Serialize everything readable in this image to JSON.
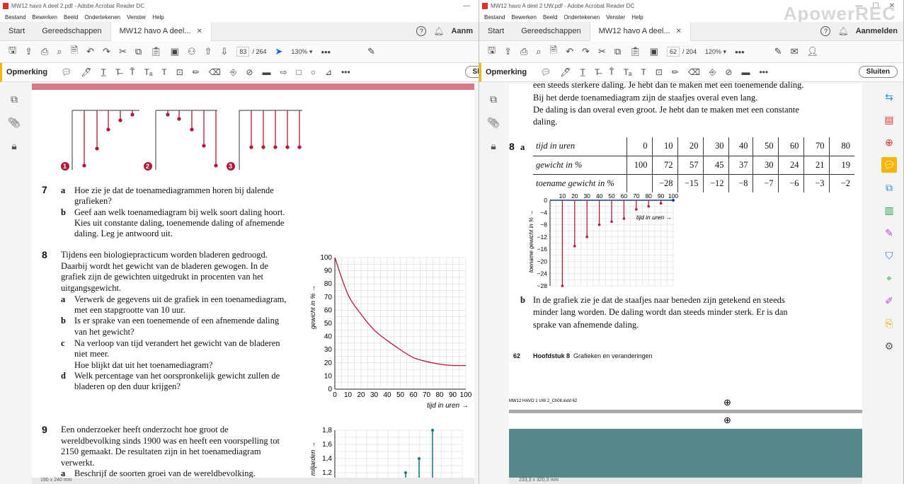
{
  "left": {
    "title": "MW12 havo A deel 2.pdf - Adobe Acrobat Reader DC",
    "menu": [
      "Bestand",
      "Bewerken",
      "Beeld",
      "Ondertekenen",
      "Venster",
      "Help"
    ],
    "tabs": {
      "start": "Start",
      "tools": "Gereedschappen",
      "doc": "MW12 havo A deel..."
    },
    "signin": "Aanm",
    "page_num": "83",
    "page_total": "/ 264",
    "zoom": "130%",
    "anno_label": "Opmerking",
    "close_label": "Sl",
    "status": "190 x 240 mm",
    "diagram_markers": [
      "1",
      "2",
      "3"
    ],
    "q7": {
      "num": "7",
      "a_letter": "a",
      "a1": "Hoe zie je dat de toenamediagrammen horen bij dalende",
      "a2": "grafieken?",
      "b_letter": "b",
      "b1": "Geef aan welk toenamediagram bij welk soort daling hoort.",
      "b2": "Kies uit constante daling, toenemende daling of afnemende",
      "b3": "daling. Leg je antwoord uit."
    },
    "q8": {
      "num": "8",
      "intro1": "Tijdens een biologiepracticum worden bladeren gedroogd.",
      "intro2": "Daarbij wordt het gewicht van de bladeren gewogen. In de",
      "intro3": "grafiek zijn de gewichten uitgedrukt in procenten van het",
      "intro4": "uitgangsgewicht.",
      "a_letter": "a",
      "a1": "Verwerk de gegevens uit de grafiek in een toenamediagram,",
      "a2": "met een stapgrootte van 10 uur.",
      "b_letter": "b",
      "b1": "Is er sprake van een toenemende of een afnemende daling",
      "b2": "van het gewicht?",
      "c_letter": "c",
      "c1": "Na verloop van tijd verandert het gewicht van de bladeren",
      "c2": "niet meer.",
      "c3": "Hoe blijkt dat uit het toenamediagram?",
      "d_letter": "d",
      "d1": "Welk percentage van het oorspronkelijk gewicht zullen de",
      "d2": "bladeren op den duur krijgen?"
    },
    "q9": {
      "num": "9",
      "l1": "Een onderzoeker heeft onderzocht hoe groot de",
      "l2": "wereldbevolking sinds 1900 was en heeft een voorspelling tot",
      "l3": "2150 gemaakt. De resultaten zijn in het toenamediagram",
      "l4": "verwerkt.",
      "a_letter": "a",
      "a1": "Beschrijf de soorten groei van de wereldbevolking."
    }
  },
  "right": {
    "title": "MW12 havo A deel 2 UW.pdf - Adobe Acrobat Reader DC",
    "menu": [
      "Bestand",
      "Bewerken",
      "Beeld",
      "Ondertekenen",
      "Venster",
      "Help"
    ],
    "tabs": {
      "start": "Start",
      "tools": "Gereedschappen",
      "doc": "MW12 havo A deel..."
    },
    "signin": "Aanmelden",
    "page_num": "62",
    "page_total": "/ 204",
    "zoom": "120%",
    "anno_label": "Opmerking",
    "close_label": "Sluiten",
    "status": "233,3 x 320,3 mm",
    "watermark": "ApowerREC",
    "top1": "een steeds sterkere daling. Je hebt dan te maken met een toenemende daling.",
    "top2": "Bij het derde toenamediagram zijn de staafjes overal even lang.",
    "top3": "De daling is dan overal even groot. Je hebt dan te maken met een constante",
    "top4": "daling.",
    "q8_num": "8",
    "q8_letter": "a",
    "table": {
      "rows": [
        [
          "tijd in uren",
          "0",
          "10",
          "20",
          "30",
          "40",
          "50",
          "60",
          "70",
          "80"
        ],
        [
          "gewicht in %",
          "100",
          "72",
          "57",
          "45",
          "37",
          "30",
          "24",
          "21",
          "19"
        ],
        [
          "toename gewicht in %",
          "",
          "−28",
          "−15",
          "−12",
          "−8",
          "−7",
          "−6",
          "−3",
          "−2"
        ]
      ]
    },
    "b_letter": "b",
    "b1": "In de grafiek zie je dat de staafjes naar beneden zijn getekend en steeds",
    "b2": "minder lang worden. De daling wordt dan steeds minder sterk. Er is dan",
    "b3": "sprake van afnemende daling.",
    "footer_num": "62",
    "footer_chap": "Hoofdstuk 8",
    "footer_title": "Grafieken en veranderingen",
    "indd": "MW12 HAVO 1 UW 2_Ch08.indd   62"
  },
  "chart_data": [
    {
      "type": "line",
      "xlabel": "tijd in uren",
      "ylabel": "gewicht in %",
      "x": [
        0,
        10,
        20,
        30,
        40,
        50,
        60,
        70,
        80,
        90,
        100
      ],
      "values": [
        100,
        72,
        57,
        45,
        37,
        30,
        24,
        21,
        19,
        18,
        18
      ],
      "xlim": [
        0,
        100
      ],
      "ylim": [
        0,
        100
      ],
      "xticks": [
        "0",
        "10",
        "20",
        "30",
        "40",
        "50",
        "60",
        "70",
        "80",
        "90",
        "100"
      ],
      "yticks": [
        "0",
        "10",
        "20",
        "30",
        "40",
        "50",
        "60",
        "70",
        "80",
        "90",
        "100"
      ],
      "grid": true
    },
    {
      "type": "bar",
      "xlabel": "tijd in uren",
      "ylabel": "toename gewicht in %",
      "x": [
        10,
        20,
        30,
        40,
        50,
        60,
        70,
        80,
        90
      ],
      "values": [
        -28,
        -15,
        -12,
        -8,
        -7,
        -6,
        -3,
        -2,
        -1
      ],
      "xticks": [
        "10",
        "20",
        "30",
        "40",
        "50",
        "60",
        "70",
        "80",
        "90",
        "100"
      ],
      "yticks": [
        "0",
        "−4",
        "−8",
        "−12",
        "−16",
        "−20",
        "−24",
        "−28"
      ],
      "ylim": [
        -28,
        0
      ],
      "grid": true
    },
    {
      "type": "bar",
      "ylabel": "in miljarden",
      "yticks": [
        "1,2",
        "1,4",
        "1,6",
        "1,8"
      ],
      "values": [
        1.2,
        1.4,
        1.8
      ],
      "ylim": [
        1.1,
        1.8
      ]
    }
  ]
}
